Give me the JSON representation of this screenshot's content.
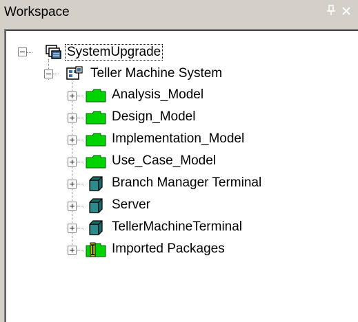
{
  "panel": {
    "title": "Workspace",
    "pin_glyph": "ᵖ",
    "close_glyph": "✕"
  },
  "tree": {
    "root": {
      "label": "SystemUpgrade",
      "icon": "project-icon",
      "expanded": true,
      "selected": true
    },
    "system": {
      "label": "Teller Machine System",
      "icon": "system-icon",
      "expanded": true
    },
    "children": [
      {
        "label": "Analysis_Model",
        "icon": "folder-icon"
      },
      {
        "label": "Design_Model",
        "icon": "folder-icon"
      },
      {
        "label": "Implementation_Model",
        "icon": "folder-icon"
      },
      {
        "label": "Use_Case_Model",
        "icon": "folder-icon"
      },
      {
        "label": "Branch Manager Terminal",
        "icon": "node-cube-icon"
      },
      {
        "label": "Server",
        "icon": "node-cube-icon"
      },
      {
        "label": "TellerMachineTerminal",
        "icon": "node-cube-icon"
      },
      {
        "label": "Imported Packages",
        "icon": "imported-package-icon"
      }
    ]
  },
  "colors": {
    "folder_green": "#00d400",
    "cube_teal": "#1e6b6b",
    "window_bg": "#d4d0c8"
  }
}
